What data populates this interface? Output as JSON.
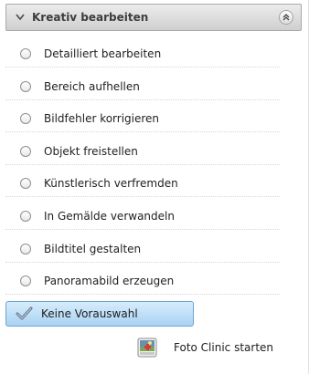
{
  "header": {
    "title": "Kreativ bearbeiten",
    "expand_icon": "chevron-down-icon",
    "collapse_icon": "double-chevron-up-icon"
  },
  "options": [
    {
      "label": "Detailliert bearbeiten"
    },
    {
      "label": "Bereich aufhellen"
    },
    {
      "label": "Bildfehler korrigieren"
    },
    {
      "label": "Objekt freistellen"
    },
    {
      "label": "Künstlerisch verfremden"
    },
    {
      "label": "In Gemälde verwandeln"
    },
    {
      "label": "Bildtitel gestalten"
    },
    {
      "label": "Panoramabild erzeugen"
    }
  ],
  "selected_option": {
    "label": "Keine Vorauswahl",
    "icon": "checkmark-icon"
  },
  "footer": {
    "label": "Foto Clinic starten",
    "icon": "foto-clinic-app-icon"
  },
  "colors": {
    "selection": "#a9d3f3",
    "header": "#cfcfcf"
  }
}
